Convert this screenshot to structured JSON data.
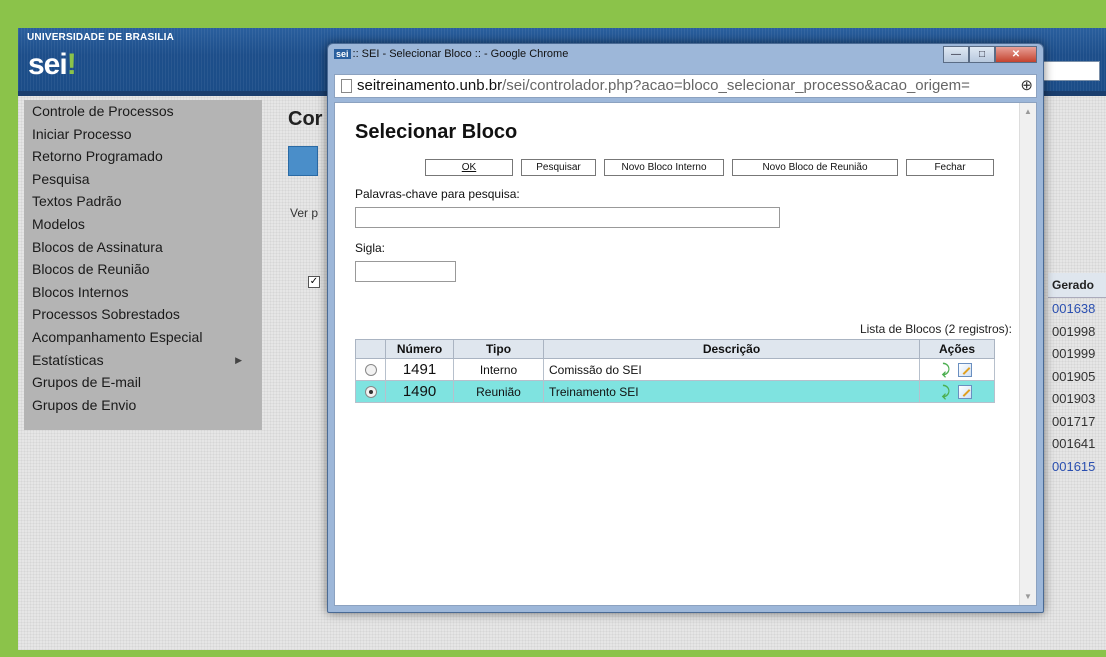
{
  "app": {
    "university": "UNIVERSIDADE DE BRASILIA",
    "logo": "sei",
    "logo_dot": "!"
  },
  "sidebar": {
    "items": [
      {
        "label": "Controle de Processos"
      },
      {
        "label": "Iniciar Processo"
      },
      {
        "label": "Retorno Programado"
      },
      {
        "label": "Pesquisa"
      },
      {
        "label": "Textos Padrão"
      },
      {
        "label": "Modelos"
      },
      {
        "label": "Blocos de Assinatura"
      },
      {
        "label": "Blocos de Reunião"
      },
      {
        "label": "Blocos Internos"
      },
      {
        "label": "Processos Sobrestados"
      },
      {
        "label": "Acompanhamento Especial"
      },
      {
        "label": "Estatísticas"
      },
      {
        "label": "Grupos de E-mail"
      },
      {
        "label": "Grupos de Envio"
      }
    ]
  },
  "background": {
    "title_partial": "Cor",
    "ver_partial": "Ver p",
    "column_header": "Gerado",
    "column_values": [
      "001638",
      "001998",
      "001999",
      "001905",
      "001903",
      "001717",
      "001641",
      "001615"
    ]
  },
  "popup": {
    "window_title": ":: SEI - Selecionar Bloco :: - Google Chrome",
    "favicon": "sei",
    "url_host": "seitreinamento.unb.br",
    "url_path": "/sei/controlador.php?acao=bloco_selecionar_processo&acao_origem=",
    "dialog_title": "Selecionar Bloco",
    "buttons": {
      "ok": "OK",
      "pesquisar": "Pesquisar",
      "novo_interno": "Novo Bloco Interno",
      "novo_reuniao": "Novo Bloco de Reunião",
      "fechar": "Fechar"
    },
    "keywords_label": "Palavras-chave para pesquisa:",
    "keywords_value": "",
    "sigla_label": "Sigla:",
    "sigla_value": "",
    "list_caption": "Lista de Blocos (2 registros):",
    "table": {
      "headers": [
        "",
        "Número",
        "Tipo",
        "Descrição",
        "Ações"
      ],
      "rows": [
        {
          "selected": false,
          "numero": "1491",
          "tipo": "Interno",
          "descricao": "Comissão do SEI"
        },
        {
          "selected": true,
          "numero": "1490",
          "tipo": "Reunião",
          "descricao": "Treinamento SEI"
        }
      ]
    }
  },
  "colors": {
    "border_green": "#8bc34a",
    "header_blue": "#1d4e8a",
    "selected_row": "#7fe3e0",
    "number_green": "#2e7d1e"
  }
}
